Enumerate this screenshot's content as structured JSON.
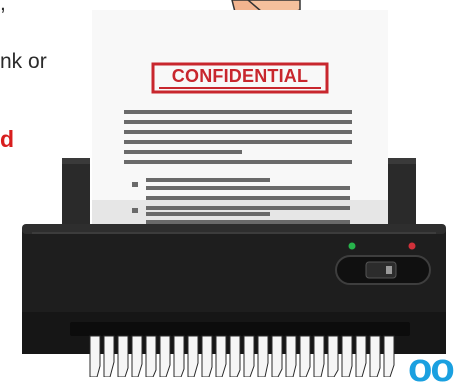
{
  "text_fragments": {
    "line_top": ",",
    "line_mid": "nk or",
    "line_red": "d"
  },
  "document": {
    "stamp": "CONFIDENTIAL"
  },
  "brand_fragment": "oo",
  "colors": {
    "stamp_red": "#c8262d",
    "highlight_red": "#d81e1e",
    "shredder_body": "#1e1e1e",
    "led_green": "#27b34b",
    "led_red": "#d0313a",
    "brand_blue": "#1aa0e0"
  }
}
